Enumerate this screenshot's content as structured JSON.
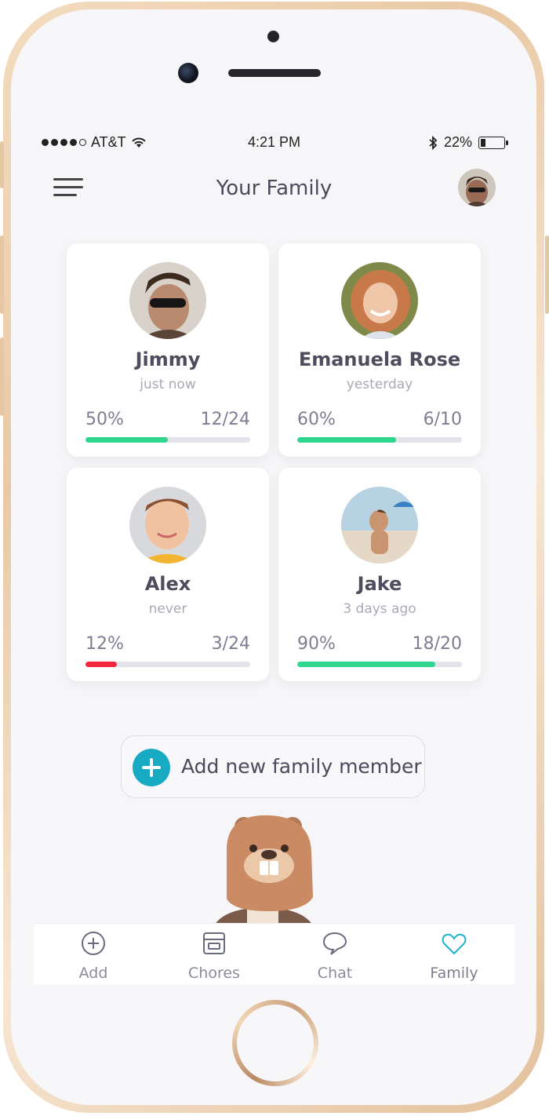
{
  "status_bar": {
    "carrier": "AT&T",
    "time": "4:21 PM",
    "battery": "22%"
  },
  "header": {
    "title": "Your Family"
  },
  "members": [
    {
      "name": "Jimmy",
      "last_seen": "just now",
      "percent": "50%",
      "count": "12/24",
      "progress": 0.5,
      "bar_color": "#2fd68f"
    },
    {
      "name": "Emanuela Rose",
      "last_seen": "yesterday",
      "percent": "60%",
      "count": "6/10",
      "progress": 0.6,
      "bar_color": "#2fd68f"
    },
    {
      "name": "Alex",
      "last_seen": "never",
      "percent": "12%",
      "count": "3/24",
      "progress": 0.19,
      "bar_color": "#f2263e"
    },
    {
      "name": "Jake",
      "last_seen": "3 days ago",
      "percent": "90%",
      "count": "18/20",
      "progress": 0.84,
      "bar_color": "#2fd68f"
    }
  ],
  "add_member": {
    "label": "Add new family member",
    "icon": "plus-icon",
    "color": "#18a9c3"
  },
  "tabs": [
    {
      "label": "Add",
      "icon": "add-circle-icon"
    },
    {
      "label": "Chores",
      "icon": "chores-icon"
    },
    {
      "label": "Chat",
      "icon": "chat-bubble-icon"
    },
    {
      "label": "Family",
      "icon": "heart-icon",
      "active": true,
      "active_color": "#1fb3c9"
    }
  ]
}
